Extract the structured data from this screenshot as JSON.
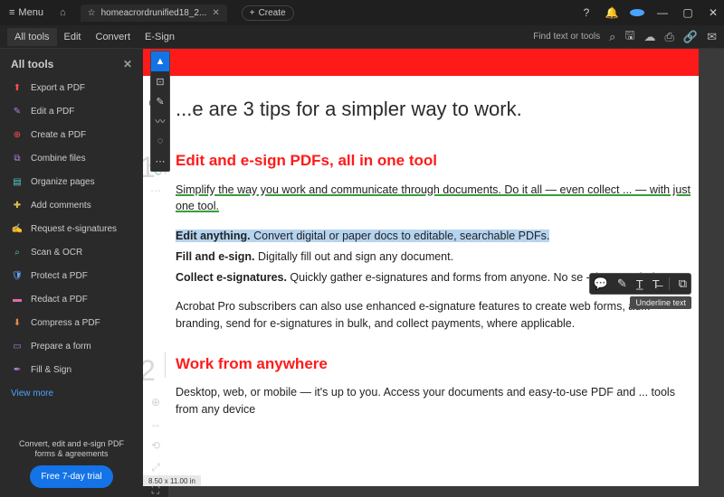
{
  "titlebar": {
    "menu": "Menu",
    "tab_name": "homeacrordrunified18_2...",
    "create": "Create"
  },
  "menubar": {
    "items": [
      "All tools",
      "Edit",
      "Convert",
      "E-Sign"
    ],
    "search": "Find text or tools"
  },
  "sidebar": {
    "title": "All tools",
    "items": [
      {
        "icon": "⬆",
        "cls": "c-red",
        "label": "Export a PDF"
      },
      {
        "icon": "✎",
        "cls": "c-purple",
        "label": "Edit a PDF"
      },
      {
        "icon": "⊕",
        "cls": "c-red",
        "label": "Create a PDF"
      },
      {
        "icon": "⧉",
        "cls": "c-purple",
        "label": "Combine files"
      },
      {
        "icon": "▤",
        "cls": "c-teal",
        "label": "Organize pages"
      },
      {
        "icon": "✚",
        "cls": "c-yellow",
        "label": "Add comments"
      },
      {
        "icon": "✍",
        "cls": "c-green",
        "label": "Request e-signatures"
      },
      {
        "icon": "⌕",
        "cls": "c-teal",
        "label": "Scan & OCR"
      },
      {
        "icon": "🛡",
        "cls": "c-blue",
        "label": "Protect a PDF"
      },
      {
        "icon": "▬",
        "cls": "c-pink",
        "label": "Redact a PDF"
      },
      {
        "icon": "⬇",
        "cls": "c-orange",
        "label": "Compress a PDF"
      },
      {
        "icon": "▭",
        "cls": "c-purple",
        "label": "Prepare a form"
      },
      {
        "icon": "✒",
        "cls": "c-purple",
        "label": "Fill & Sign"
      }
    ],
    "view_more": "View more",
    "promo_text": "Convert, edit and e-sign PDF forms & agreements",
    "promo_btn": "Free 7-day trial"
  },
  "document": {
    "heading": "...e are 3 tips for a simpler way to work.",
    "sec1_title": "Edit and e-sign PDFs, all in one tool",
    "link_text": "Simplify the way you work and communicate through documents. Do it all — even collect ... — with just one tool.",
    "p_edit_b": "Edit anything.",
    "p_edit_r": " Convert digital or paper docs to editable, searchable PDFs.",
    "p_fill_b": "Fill and e-sign.",
    "p_fill_r": " Digitally fill out and sign any document.",
    "p_collect_b": "Collect e-signatures.",
    "p_collect_r": " Quickly gather e-signatures and forms from anyone. No se            -sig... needed.",
    "p_sub": "Acrobat Pro subscribers can also use enhanced e-signature features to create web forms, ad... branding, send for e-signatures in bulk, and collect payments, where applicable.",
    "sec2_title": "Work from anywhere",
    "p_sec2": "Desktop, web, or mobile — it's up to you. Access your documents and easy-to-use PDF and ... tools from any device"
  },
  "tooltip": "Underline text",
  "pages": {
    "current": "1",
    "next": "2"
  },
  "status": "8.50 x 11.00 in"
}
